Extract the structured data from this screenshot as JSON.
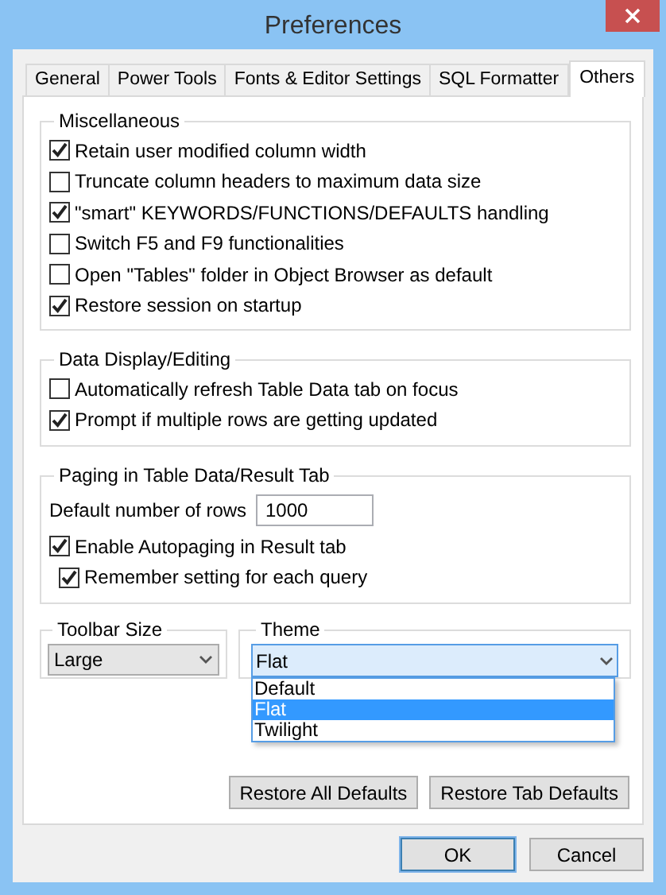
{
  "window": {
    "title": "Preferences"
  },
  "tabs": [
    {
      "label": "General",
      "selected": false
    },
    {
      "label": "Power Tools",
      "selected": false
    },
    {
      "label": "Fonts & Editor Settings",
      "selected": false
    },
    {
      "label": "SQL Formatter",
      "selected": false
    },
    {
      "label": "Others",
      "selected": true
    }
  ],
  "groups": [
    {
      "title": "Miscellaneous",
      "items": [
        {
          "kind": "checkbox",
          "label": "Retain user modified column width",
          "checked": true
        },
        {
          "kind": "checkbox",
          "label": "Truncate column headers to maximum data size",
          "checked": false
        },
        {
          "kind": "checkbox",
          "label": "\"smart\" KEYWORDS/FUNCTIONS/DEFAULTS handling",
          "checked": true
        },
        {
          "kind": "checkbox",
          "label": "Switch F5 and F9 functionalities",
          "checked": false
        },
        {
          "kind": "checkbox",
          "label": "Open \"Tables\" folder in Object Browser as default",
          "checked": false
        },
        {
          "kind": "checkbox",
          "label": "Restore session on startup",
          "checked": true
        }
      ]
    },
    {
      "title": "Data Display/Editing",
      "items": [
        {
          "kind": "checkbox",
          "label": "Automatically refresh Table Data tab on focus",
          "checked": false
        },
        {
          "kind": "checkbox",
          "label": "Prompt if multiple rows are getting updated",
          "checked": true
        }
      ]
    },
    {
      "title": "Paging in Table Data/Result Tab",
      "items": [
        {
          "kind": "field",
          "label": "Default number of rows",
          "value": "1000"
        },
        {
          "kind": "checkbox",
          "label": "Enable Autopaging in Result tab",
          "checked": true,
          "children": [
            {
              "kind": "checkbox",
              "label": "Remember setting for each query",
              "checked": true
            }
          ]
        }
      ]
    }
  ],
  "toolbar_size": {
    "title": "Toolbar Size",
    "value": "Large"
  },
  "theme": {
    "title": "Theme",
    "value": "Flat",
    "expanded": true,
    "options": [
      {
        "label": "Default",
        "selected": false
      },
      {
        "label": "Flat",
        "selected": true
      },
      {
        "label": "Twilight",
        "selected": false
      }
    ]
  },
  "restore_buttons": [
    "Restore All Defaults",
    "Restore Tab Defaults"
  ],
  "buttons": [
    {
      "label": "OK",
      "default": true
    },
    {
      "label": "Cancel",
      "default": false
    }
  ]
}
